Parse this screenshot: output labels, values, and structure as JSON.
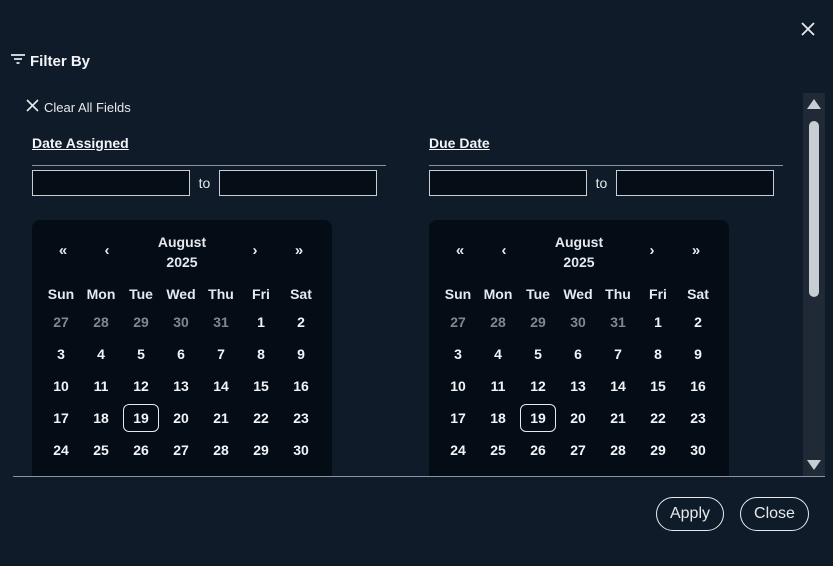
{
  "header": {
    "title": "Filter By",
    "filter_icon": "filter-icon"
  },
  "clear_all_label": "Clear All Fields",
  "sections": [
    {
      "title": "Date Assigned",
      "from_value": "",
      "to_label": "to",
      "to_value": "",
      "calendar": {
        "month": "August",
        "year": "2025",
        "nav": {
          "prev_year": "«",
          "prev_month": "‹",
          "next_month": "›",
          "next_year": "»"
        },
        "weekdays": [
          "Sun",
          "Mon",
          "Tue",
          "Wed",
          "Thu",
          "Fri",
          "Sat"
        ],
        "today": "19",
        "weeks": [
          [
            {
              "d": "27",
              "m": true
            },
            {
              "d": "28",
              "m": true
            },
            {
              "d": "29",
              "m": true
            },
            {
              "d": "30",
              "m": true
            },
            {
              "d": "31",
              "m": true
            },
            {
              "d": "1"
            },
            {
              "d": "2"
            }
          ],
          [
            {
              "d": "3"
            },
            {
              "d": "4"
            },
            {
              "d": "5"
            },
            {
              "d": "6"
            },
            {
              "d": "7"
            },
            {
              "d": "8"
            },
            {
              "d": "9"
            }
          ],
          [
            {
              "d": "10"
            },
            {
              "d": "11"
            },
            {
              "d": "12"
            },
            {
              "d": "13"
            },
            {
              "d": "14"
            },
            {
              "d": "15"
            },
            {
              "d": "16"
            }
          ],
          [
            {
              "d": "17"
            },
            {
              "d": "18"
            },
            {
              "d": "19",
              "t": true
            },
            {
              "d": "20"
            },
            {
              "d": "21"
            },
            {
              "d": "22"
            },
            {
              "d": "23"
            }
          ],
          [
            {
              "d": "24"
            },
            {
              "d": "25"
            },
            {
              "d": "26"
            },
            {
              "d": "27"
            },
            {
              "d": "28"
            },
            {
              "d": "29"
            },
            {
              "d": "30"
            }
          ]
        ]
      }
    },
    {
      "title": "Due Date",
      "from_value": "",
      "to_label": "to",
      "to_value": "",
      "calendar": {
        "month": "August",
        "year": "2025",
        "nav": {
          "prev_year": "«",
          "prev_month": "‹",
          "next_month": "›",
          "next_year": "»"
        },
        "weekdays": [
          "Sun",
          "Mon",
          "Tue",
          "Wed",
          "Thu",
          "Fri",
          "Sat"
        ],
        "today": "19",
        "weeks": [
          [
            {
              "d": "27",
              "m": true
            },
            {
              "d": "28",
              "m": true
            },
            {
              "d": "29",
              "m": true
            },
            {
              "d": "30",
              "m": true
            },
            {
              "d": "31",
              "m": true
            },
            {
              "d": "1"
            },
            {
              "d": "2"
            }
          ],
          [
            {
              "d": "3"
            },
            {
              "d": "4"
            },
            {
              "d": "5"
            },
            {
              "d": "6"
            },
            {
              "d": "7"
            },
            {
              "d": "8"
            },
            {
              "d": "9"
            }
          ],
          [
            {
              "d": "10"
            },
            {
              "d": "11"
            },
            {
              "d": "12"
            },
            {
              "d": "13"
            },
            {
              "d": "14"
            },
            {
              "d": "15"
            },
            {
              "d": "16"
            }
          ],
          [
            {
              "d": "17"
            },
            {
              "d": "18"
            },
            {
              "d": "19",
              "t": true
            },
            {
              "d": "20"
            },
            {
              "d": "21"
            },
            {
              "d": "22"
            },
            {
              "d": "23"
            }
          ],
          [
            {
              "d": "24"
            },
            {
              "d": "25"
            },
            {
              "d": "26"
            },
            {
              "d": "27"
            },
            {
              "d": "28"
            },
            {
              "d": "29"
            },
            {
              "d": "30"
            }
          ]
        ]
      }
    }
  ],
  "buttons": {
    "apply": "Apply",
    "close": "Close"
  },
  "colors": {
    "background": "#0f1b28",
    "calendar_bg": "#040c15",
    "text": "#e6e9ee",
    "muted": "#7e8792"
  }
}
